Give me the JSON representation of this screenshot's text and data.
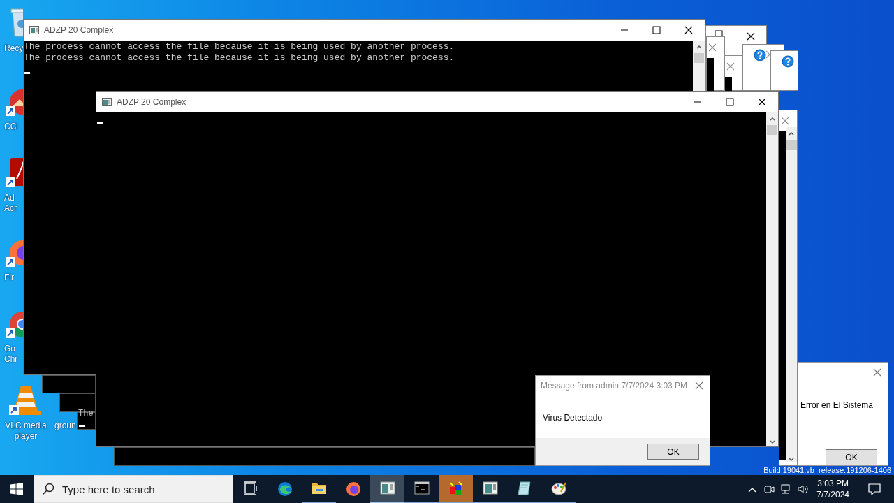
{
  "desktop_icons": [
    {
      "kind": "recycle",
      "lines": [
        "Recy"
      ]
    },
    {
      "kind": "ccleaner",
      "lines": [
        "CCl"
      ]
    },
    {
      "kind": "acrobat",
      "lines": [
        "Ad",
        "Acr"
      ]
    },
    {
      "kind": "firefox",
      "lines": [
        "Fir"
      ]
    },
    {
      "kind": "chrome",
      "lines": [
        "Go",
        "Chr"
      ]
    },
    {
      "kind": "vlc",
      "lines": [
        "VLC media",
        "player"
      ]
    },
    {
      "kind": "blank",
      "lines": [
        "groun"
      ]
    }
  ],
  "console_windows": [
    {
      "title": "ADZP 20 Complex",
      "lines": [
        "The process cannot access the file because it is being used by another process.",
        "The process cannot access the file because it is being used by another process."
      ]
    },
    {
      "title": "ADZP 20 Complex"
    }
  ],
  "background_console": {
    "text": "The"
  },
  "dialogs": [
    {
      "kind": "message",
      "title": "Message from admin 7/7/2024 3:03 PM",
      "message": "Virus Detectado",
      "button": "OK"
    },
    {
      "kind": "error",
      "message": "Error en El Sistema",
      "button": "OK"
    }
  ],
  "build_label": "Build 19041.vb_release.191206-1406",
  "taskbar": {
    "search_placeholder": "Type here to search",
    "apps": [
      {
        "kind": "task-view",
        "selected": false,
        "running": false,
        "flashing": false
      },
      {
        "kind": "edge",
        "selected": false,
        "running": false,
        "flashing": false
      },
      {
        "kind": "explorer",
        "selected": false,
        "running": true,
        "flashing": false
      },
      {
        "kind": "firefox",
        "selected": false,
        "running": false,
        "flashing": false
      },
      {
        "kind": "console",
        "selected": true,
        "running": true,
        "flashing": false
      },
      {
        "kind": "cmd",
        "selected": false,
        "running": true,
        "flashing": false
      },
      {
        "kind": "blocks",
        "selected": false,
        "running": true,
        "flashing": true
      },
      {
        "kind": "window",
        "selected": false,
        "running": true,
        "flashing": false
      },
      {
        "kind": "notepad",
        "selected": false,
        "running": true,
        "flashing": false
      },
      {
        "kind": "paint",
        "selected": false,
        "running": true,
        "flashing": false
      }
    ],
    "time": "3:03 PM",
    "date": "7/7/2024"
  }
}
